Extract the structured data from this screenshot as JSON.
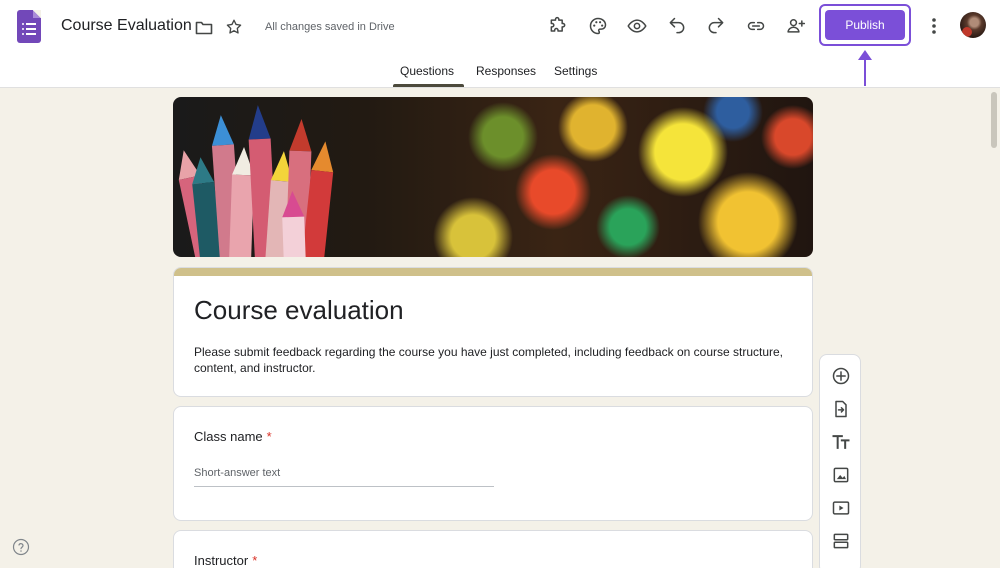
{
  "header": {
    "doc_title": "Course Evaluation",
    "saved_status": "All changes saved in Drive",
    "publish_label": "Publish",
    "icons": [
      "forms-app-icon",
      "folder-icon",
      "star-icon",
      "addon-puzzle-icon",
      "palette-icon",
      "preview-eye-icon",
      "undo-icon",
      "redo-icon",
      "link-icon",
      "add-collaborator-icon",
      "more-vert-icon"
    ]
  },
  "tabs": [
    {
      "label": "Questions",
      "active": true
    },
    {
      "label": "Responses",
      "active": false
    },
    {
      "label": "Settings",
      "active": false
    }
  ],
  "form": {
    "title": "Course evaluation",
    "description": "Please submit feedback regarding the course you have just completed, including feedback on course structure, content, and instructor.",
    "questions": [
      {
        "label": "Class name",
        "required_mark": "*",
        "placeholder": "Short-answer text"
      },
      {
        "label": "Instructor",
        "required_mark": "*"
      }
    ]
  },
  "toolbar": {
    "icons": [
      "add-question-icon",
      "import-questions-icon",
      "add-title-icon",
      "add-image-icon",
      "add-video-icon",
      "add-section-icon"
    ]
  },
  "colors": {
    "accent": "#7b4fd8",
    "theme": "#cfc08a",
    "background": "#f4f1e8"
  }
}
